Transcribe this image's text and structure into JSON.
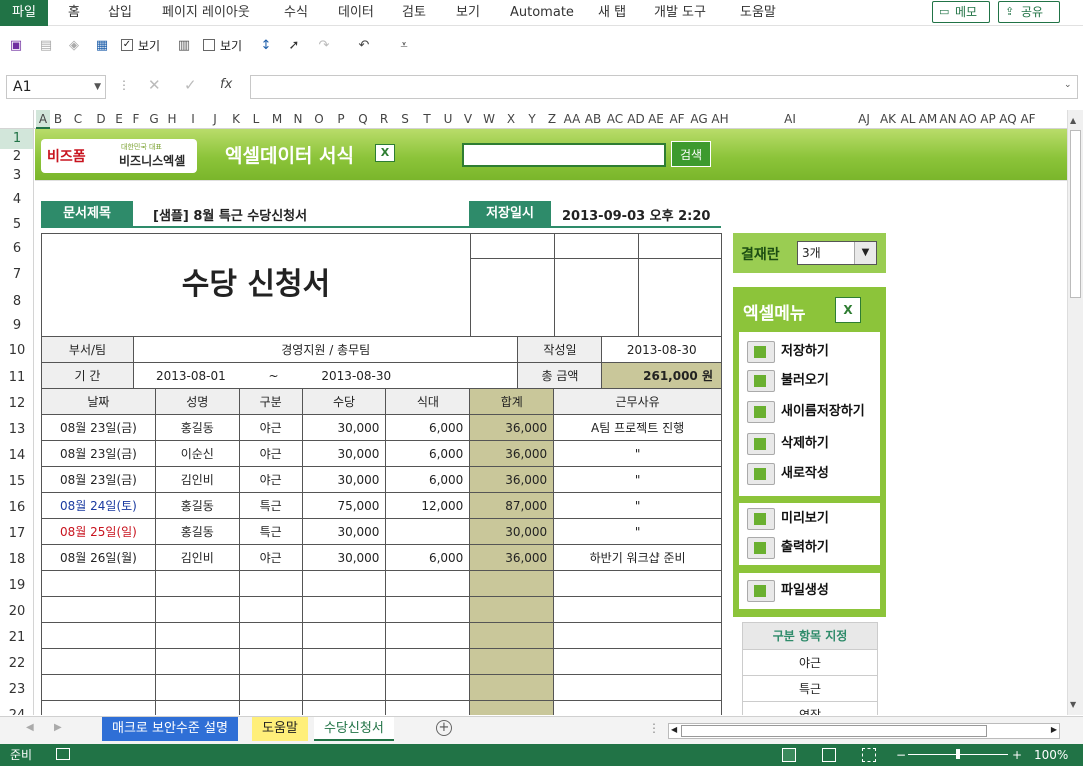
{
  "ribbon": {
    "tabs": [
      "파일",
      "홈",
      "삽입",
      "페이지 레이아웃",
      "수식",
      "데이터",
      "검토",
      "보기",
      "Automate",
      "새 탭",
      "개발 도구",
      "도움말"
    ],
    "memo_button": "메모",
    "share_button": "공유"
  },
  "qat": {
    "view_label_1": "보기",
    "view_label_2": "보기"
  },
  "formula_bar": {
    "name_box": "A1",
    "fx": "fx",
    "content": ""
  },
  "columns": [
    "A",
    "B",
    "C",
    "D",
    "E",
    "F",
    "G",
    "H",
    "I",
    "J",
    "K",
    "L",
    "M",
    "N",
    "O",
    "P",
    "Q",
    "R",
    "S",
    "T",
    "U",
    "V",
    "W",
    "X",
    "Y",
    "Z",
    "AA",
    "AB",
    "AC",
    "AD",
    "AE",
    "AF",
    "AG",
    "AH",
    "AI",
    "AJ",
    "AK",
    "AL",
    "AM",
    "AN",
    "AO",
    "AP",
    "AQ",
    "AF"
  ],
  "rows": [
    "1",
    "2",
    "3",
    "4",
    "5",
    "6",
    "7",
    "8",
    "9",
    "10",
    "11",
    "12",
    "13",
    "14",
    "15",
    "16",
    "17",
    "18",
    "19",
    "20",
    "21",
    "22",
    "23",
    "24"
  ],
  "banner": {
    "logo_text": "비즈폼",
    "logo_sub": "비즈니스엑셀",
    "logo_tag": "대한민국 대표",
    "title": "엑셀데이터 서식",
    "search_value": "",
    "search_button": "검색"
  },
  "doc_info": {
    "title_label": "문서제목",
    "title_value": "[샘플] 8월 특근 수당신청서",
    "saved_label": "저장일시",
    "saved_value": "2013-09-03  오후 2:20"
  },
  "form": {
    "heading": "수당 신청서",
    "dept_label": "부서/팀",
    "dept_value": "경영지원 / 총무팀",
    "date_label": "작성일",
    "date_value": "2013-08-30",
    "period_label": "기    간",
    "period_start": "2013-08-01",
    "period_sep": "~",
    "period_end": "2013-08-30",
    "total_label": "총 금액",
    "total_value": "261,000  원",
    "columns": [
      "날짜",
      "성명",
      "구분",
      "수당",
      "식대",
      "합계",
      "근무사유"
    ],
    "rows": [
      {
        "date": "08월 23일(금)",
        "name": "홍길동",
        "type": "야근",
        "pay": "30,000",
        "meal": "6,000",
        "sum": "36,000",
        "reason": "A팀 프로젝트 진행",
        "color": "normal"
      },
      {
        "date": "08월 23일(금)",
        "name": "이순신",
        "type": "야근",
        "pay": "30,000",
        "meal": "6,000",
        "sum": "36,000",
        "reason": "\"",
        "color": "normal"
      },
      {
        "date": "08월 23일(금)",
        "name": "김인비",
        "type": "야근",
        "pay": "30,000",
        "meal": "6,000",
        "sum": "36,000",
        "reason": "\"",
        "color": "normal"
      },
      {
        "date": "08월 24일(토)",
        "name": "홍길동",
        "type": "특근",
        "pay": "75,000",
        "meal": "12,000",
        "sum": "87,000",
        "reason": "\"",
        "color": "blue"
      },
      {
        "date": "08월 25일(일)",
        "name": "홍길동",
        "type": "특근",
        "pay": "30,000",
        "meal": "",
        "sum": "30,000",
        "reason": "\"",
        "color": "red"
      },
      {
        "date": "08월 26일(월)",
        "name": "김인비",
        "type": "야근",
        "pay": "30,000",
        "meal": "6,000",
        "sum": "36,000",
        "reason": "하반기 워크샵 준비",
        "color": "normal"
      }
    ]
  },
  "side": {
    "approval_label": "결재란",
    "approval_value": "3개",
    "menu_title": "엑셀메뉴",
    "menu_group1": [
      "저장하기",
      "불러오기",
      "새이름저장하기",
      "삭제하기",
      "새로작성"
    ],
    "menu_group2": [
      "미리보기",
      "출력하기"
    ],
    "menu_group3": [
      "파일생성"
    ],
    "category_title": "구분 항목 지정",
    "categories": [
      "야근",
      "특근",
      "연장"
    ]
  },
  "sheet_tabs": [
    "매크로 보안수준 설명",
    "도움말",
    "수당신청서"
  ],
  "status": {
    "ready": "준비",
    "zoom": "100%"
  },
  "colors": {
    "excel_green": "#217346",
    "banner_green": "#8cc43a",
    "band_teal": "#2e8b6a",
    "sum_fill": "#c9c79a"
  }
}
